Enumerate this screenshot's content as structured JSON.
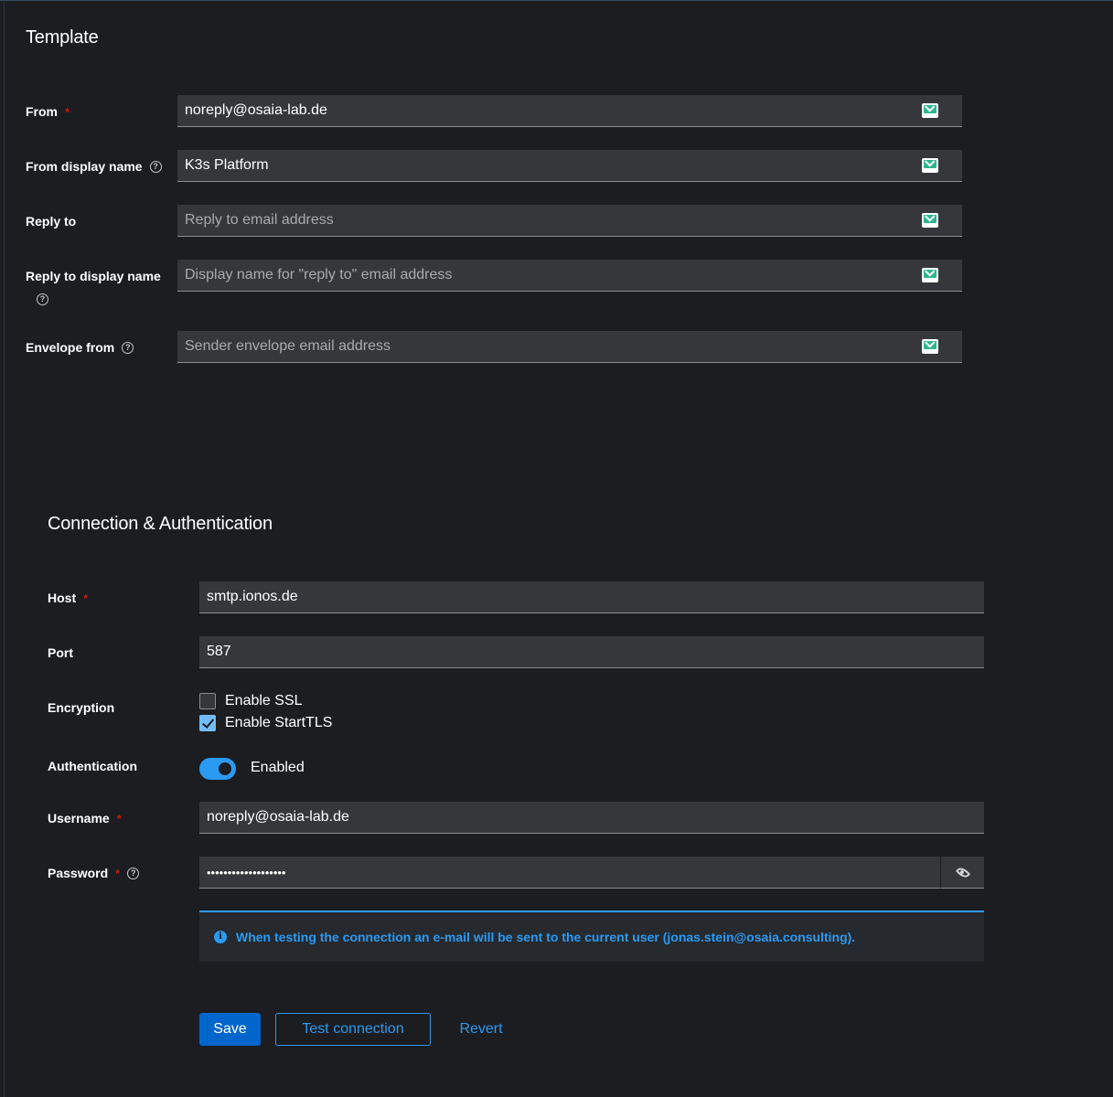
{
  "template": {
    "title": "Template",
    "from": {
      "label": "From",
      "required": "*",
      "value": "noreply@osaia-lab.de"
    },
    "from_display_name": {
      "label": "From display name",
      "value": "K3s Platform"
    },
    "reply_to": {
      "label": "Reply to",
      "placeholder": "Reply to email address"
    },
    "reply_to_display_name": {
      "label": "Reply to display name",
      "placeholder": "Display name for \"reply to\" email address"
    },
    "envelope_from": {
      "label": "Envelope from",
      "placeholder": "Sender envelope email address"
    }
  },
  "connection": {
    "title": "Connection & Authentication",
    "host": {
      "label": "Host",
      "required": "*",
      "value": "smtp.ionos.de"
    },
    "port": {
      "label": "Port",
      "value": "587"
    },
    "encryption": {
      "label": "Encryption",
      "ssl_label": "Enable SSL",
      "ssl_checked": false,
      "starttls_label": "Enable StartTLS",
      "starttls_checked": true
    },
    "authentication": {
      "label": "Authentication",
      "state": "Enabled",
      "on": true
    },
    "username": {
      "label": "Username",
      "required": "*",
      "value": "noreply@osaia-lab.de"
    },
    "password": {
      "label": "Password",
      "required": "*",
      "value": "•••••••••••••••••••"
    },
    "info": "When testing the connection an e-mail will be sent to the current user (jonas.stein@osaia.consulting)."
  },
  "actions": {
    "save": "Save",
    "test": "Test connection",
    "revert": "Revert"
  },
  "help_glyph": "?",
  "info_glyph": "i",
  "colors": {
    "primary": "#0066cc",
    "link": "#2b9af3",
    "required": "#c9190b",
    "background": "#1b1d21",
    "input": "#36373a"
  }
}
